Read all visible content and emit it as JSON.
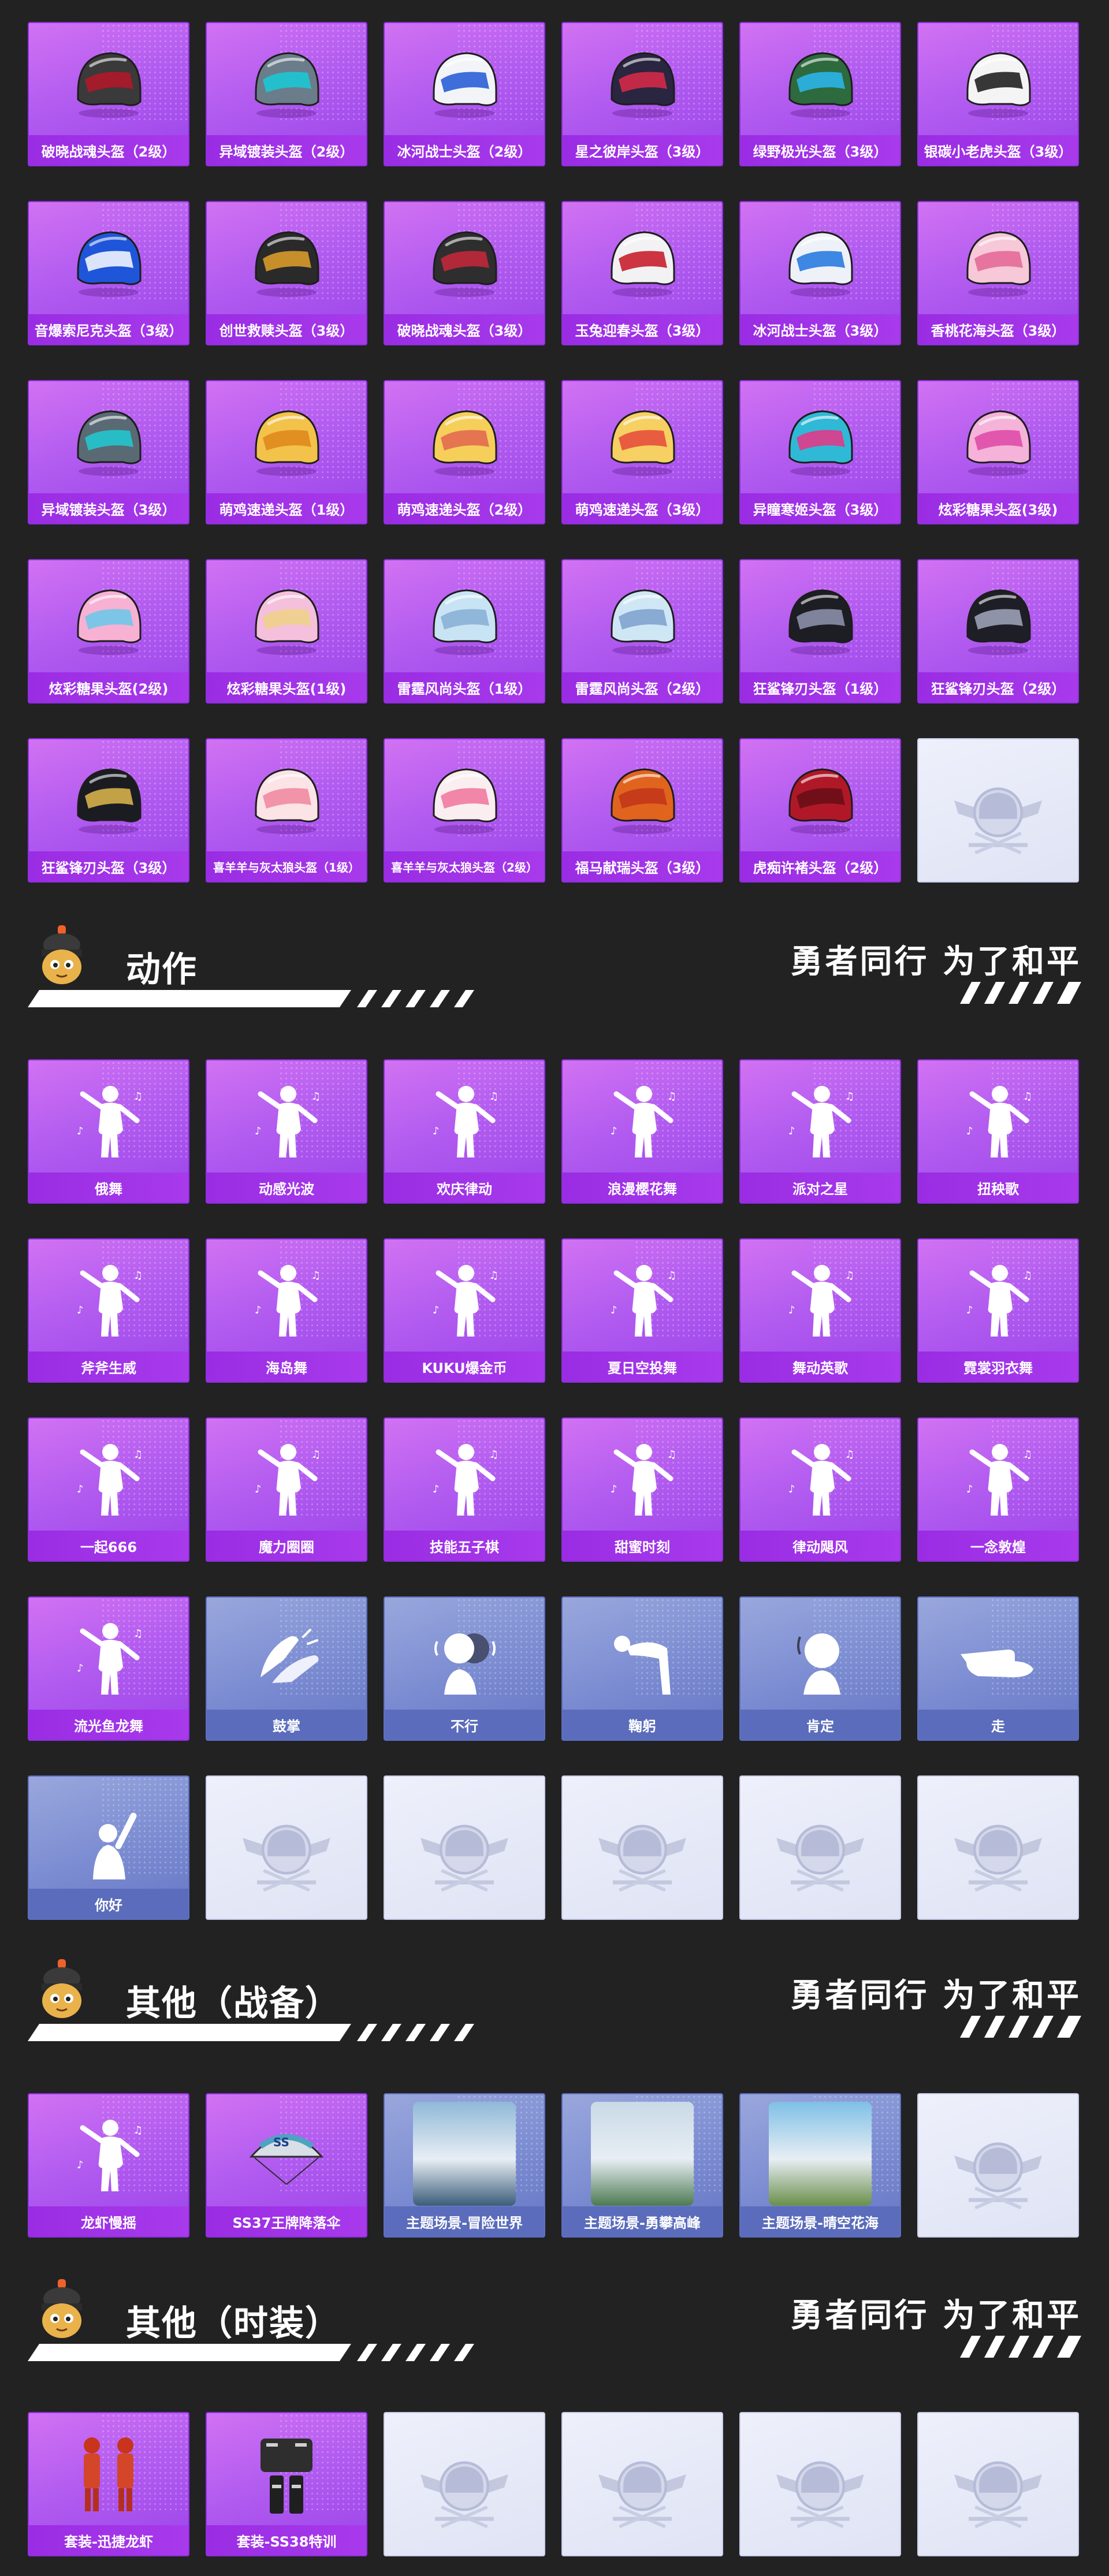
{
  "colors": {
    "background": "#222222",
    "card_purple": "#b25cf0",
    "card_label_purple": "#a83aec",
    "card_blue": "#7a8bd1",
    "card_label_blue": "#5a6cbb",
    "card_empty": "#e6e9f7"
  },
  "slogan": "勇者同行 为了和平",
  "helmets": [
    {
      "label": "破晓战魂头盔（2级）",
      "art": "helmet",
      "c1": "#3a3a3a",
      "c2": "#b0182a",
      "style": "purple"
    },
    {
      "label": "异域镀装头盔（2级）",
      "art": "helmet",
      "c1": "#6b7d8a",
      "c2": "#1dc6d4",
      "style": "purple"
    },
    {
      "label": "冰河战士头盔（2级）",
      "art": "helmet",
      "c1": "#f2f4f8",
      "c2": "#2a5fd6",
      "style": "purple"
    },
    {
      "label": "星之彼岸头盔（3级）",
      "art": "helmet",
      "c1": "#2a2540",
      "c2": "#d22a48",
      "style": "purple"
    },
    {
      "label": "绿野极光头盔（3级）",
      "art": "helmet",
      "c1": "#2d6a3e",
      "c2": "#2bb5e8",
      "style": "purple"
    },
    {
      "label": "银碳小老虎头盔（3级）",
      "art": "helmet",
      "c1": "#f4f4f4",
      "c2": "#222222",
      "style": "purple"
    },
    {
      "label": "音爆索尼克头盔（3级）",
      "art": "helmet",
      "c1": "#1f55d8",
      "c2": "#f0f4ff",
      "style": "purple"
    },
    {
      "label": "创世救赎头盔（3级）",
      "art": "helmet",
      "c1": "#2a2a2a",
      "c2": "#d79a2a",
      "style": "purple"
    },
    {
      "label": "破晓战魂头盔（3级）",
      "art": "helmet",
      "c1": "#2e2e2e",
      "c2": "#c0283a",
      "style": "purple"
    },
    {
      "label": "玉兔迎春头盔（3级）",
      "art": "helmet",
      "c1": "#f2f2f4",
      "c2": "#c81f2e",
      "style": "purple"
    },
    {
      "label": "冰河战士头盔（3级）",
      "art": "helmet",
      "c1": "#eef2f8",
      "c2": "#2a7be0",
      "style": "purple"
    },
    {
      "label": "香桃花海头盔（3级）",
      "art": "helmet",
      "c1": "#f6c8d8",
      "c2": "#e56a98",
      "style": "purple"
    },
    {
      "label": "异域镀装头盔（3级）",
      "art": "helmet",
      "c1": "#5a6a74",
      "c2": "#22c6cf",
      "style": "purple"
    },
    {
      "label": "萌鸡速递头盔（1级）",
      "art": "helmet",
      "c1": "#f3c24a",
      "c2": "#e08a1e",
      "style": "purple"
    },
    {
      "label": "萌鸡速递头盔（2级）",
      "art": "helmet",
      "c1": "#f6cf5a",
      "c2": "#e36a50",
      "style": "purple"
    },
    {
      "label": "萌鸡速递头盔（3级）",
      "art": "helmet",
      "c1": "#f6d062",
      "c2": "#e7503c",
      "style": "purple"
    },
    {
      "label": "异瞳寒姬头盔（3级）",
      "art": "helmet",
      "c1": "#2fb9d6",
      "c2": "#e13a8a",
      "style": "purple"
    },
    {
      "label": "炫彩糖果头盔(3级)",
      "art": "helmet",
      "c1": "#f5b3d9",
      "c2": "#e04ca8",
      "style": "purple"
    },
    {
      "label": "炫彩糖果头盔(2级)",
      "art": "helmet",
      "c1": "#f7b1d3",
      "c2": "#6ec8e8",
      "style": "purple"
    },
    {
      "label": "炫彩糖果头盔(1级)",
      "art": "helmet",
      "c1": "#f5c0dc",
      "c2": "#f0d08a",
      "style": "purple"
    },
    {
      "label": "雷霆风尚头盔（1级）",
      "art": "helmet",
      "c1": "#c8e4f4",
      "c2": "#8ab0d6",
      "style": "purple"
    },
    {
      "label": "雷霆风尚头盔（2级）",
      "art": "helmet",
      "c1": "#cfe7f5",
      "c2": "#7fa3cf",
      "style": "purple"
    },
    {
      "label": "狂鲨锋刃头盔（1级）",
      "art": "helmet",
      "c1": "#1d1d24",
      "c2": "#8b8fa8",
      "style": "purple"
    },
    {
      "label": "狂鲨锋刃头盔（2级）",
      "art": "helmet",
      "c1": "#1e1f26",
      "c2": "#9aa0b6",
      "style": "purple"
    },
    {
      "label": "狂鲨锋刃头盔（3级）",
      "art": "helmet",
      "c1": "#1b1c22",
      "c2": "#d6b04a",
      "style": "purple"
    },
    {
      "label": "喜羊羊与灰太狼头盔（1级）",
      "art": "helmet",
      "c1": "#fbe3e6",
      "c2": "#ef8aa2",
      "style": "purple",
      "small": true
    },
    {
      "label": "喜羊羊与灰太狼头盔（2级）",
      "art": "helmet",
      "c1": "#fbeef0",
      "c2": "#f07aa0",
      "style": "purple",
      "small": true
    },
    {
      "label": "福马献瑞头盔（3级）",
      "art": "helmet",
      "c1": "#e0641e",
      "c2": "#c3361a",
      "style": "purple"
    },
    {
      "label": "虎痴许褚头盔（2级）",
      "art": "helmet",
      "c1": "#b01828",
      "c2": "#6a0e16",
      "style": "purple"
    },
    {
      "label": "",
      "art": "emblem",
      "style": "empty"
    }
  ],
  "section_actions": {
    "title": "动作"
  },
  "actions": [
    {
      "label": "俄舞",
      "art": "dancer",
      "style": "purple"
    },
    {
      "label": "动感光波",
      "art": "dancer",
      "style": "purple"
    },
    {
      "label": "欢庆律动",
      "art": "dancer",
      "style": "purple"
    },
    {
      "label": "浪漫樱花舞",
      "art": "dancer",
      "style": "purple"
    },
    {
      "label": "派对之星",
      "art": "dancer",
      "style": "purple"
    },
    {
      "label": "扭秧歌",
      "art": "dancer",
      "style": "purple"
    },
    {
      "label": "斧斧生威",
      "art": "dancer",
      "style": "purple"
    },
    {
      "label": "海岛舞",
      "art": "dancer",
      "style": "purple"
    },
    {
      "label": "KUKU爆金币",
      "art": "dancer",
      "style": "purple"
    },
    {
      "label": "夏日空投舞",
      "art": "dancer",
      "style": "purple"
    },
    {
      "label": "舞动英歌",
      "art": "dancer",
      "style": "purple"
    },
    {
      "label": "霓裳羽衣舞",
      "art": "dancer",
      "style": "purple"
    },
    {
      "label": "一起666",
      "art": "dancer",
      "style": "purple"
    },
    {
      "label": "魔力圈圈",
      "art": "dancer",
      "style": "purple"
    },
    {
      "label": "技能五子棋",
      "art": "dancer",
      "style": "purple"
    },
    {
      "label": "甜蜜时刻",
      "art": "dancer",
      "style": "purple"
    },
    {
      "label": "律动飓风",
      "art": "dancer",
      "style": "purple"
    },
    {
      "label": "一念敦煌",
      "art": "dancer",
      "style": "purple"
    },
    {
      "label": "流光鱼龙舞",
      "art": "dancer",
      "style": "purple"
    },
    {
      "label": "鼓掌",
      "art": "clap",
      "style": "blue"
    },
    {
      "label": "不行",
      "art": "shake",
      "style": "blue"
    },
    {
      "label": "鞠躬",
      "art": "bow",
      "style": "blue"
    },
    {
      "label": "肯定",
      "art": "nod",
      "style": "blue"
    },
    {
      "label": "走",
      "art": "point",
      "style": "blue"
    },
    {
      "label": "你好",
      "art": "wave",
      "style": "blue"
    },
    {
      "label": "",
      "art": "emblem",
      "style": "empty"
    },
    {
      "label": "",
      "art": "emblem",
      "style": "empty"
    },
    {
      "label": "",
      "art": "emblem",
      "style": "empty"
    },
    {
      "label": "",
      "art": "emblem",
      "style": "empty"
    },
    {
      "label": "",
      "art": "emblem",
      "style": "empty"
    }
  ],
  "section_gear": {
    "title": "其他（战备）"
  },
  "gear": [
    {
      "label": "龙虾慢摇",
      "art": "dancer",
      "style": "purple"
    },
    {
      "label": "SS37王牌降落伞",
      "art": "parachute",
      "style": "purple"
    },
    {
      "label": "主题场景-冒险世界",
      "art": "scene",
      "sky": "#8fb9d8",
      "ground": "#3b5d7a",
      "style": "blue"
    },
    {
      "label": "主题场景-勇攀高峰",
      "art": "scene",
      "sky": "#c9d9e6",
      "ground": "#4d7a52",
      "style": "blue"
    },
    {
      "label": "主题场景-晴空花海",
      "art": "scene",
      "sky": "#7fc0e6",
      "ground": "#6a8f4a",
      "style": "blue"
    },
    {
      "label": "",
      "art": "emblem",
      "style": "empty"
    }
  ],
  "section_outfit": {
    "title": "其他（时装）"
  },
  "outfits": [
    {
      "label": "套装-迅捷龙虾",
      "art": "suit-red",
      "style": "purple"
    },
    {
      "label": "套装-SS38特训",
      "art": "suit-dark",
      "style": "purple"
    },
    {
      "label": "",
      "art": "emblem",
      "style": "empty"
    },
    {
      "label": "",
      "art": "emblem",
      "style": "empty"
    },
    {
      "label": "",
      "art": "emblem",
      "style": "empty"
    },
    {
      "label": "",
      "art": "emblem",
      "style": "empty"
    }
  ]
}
